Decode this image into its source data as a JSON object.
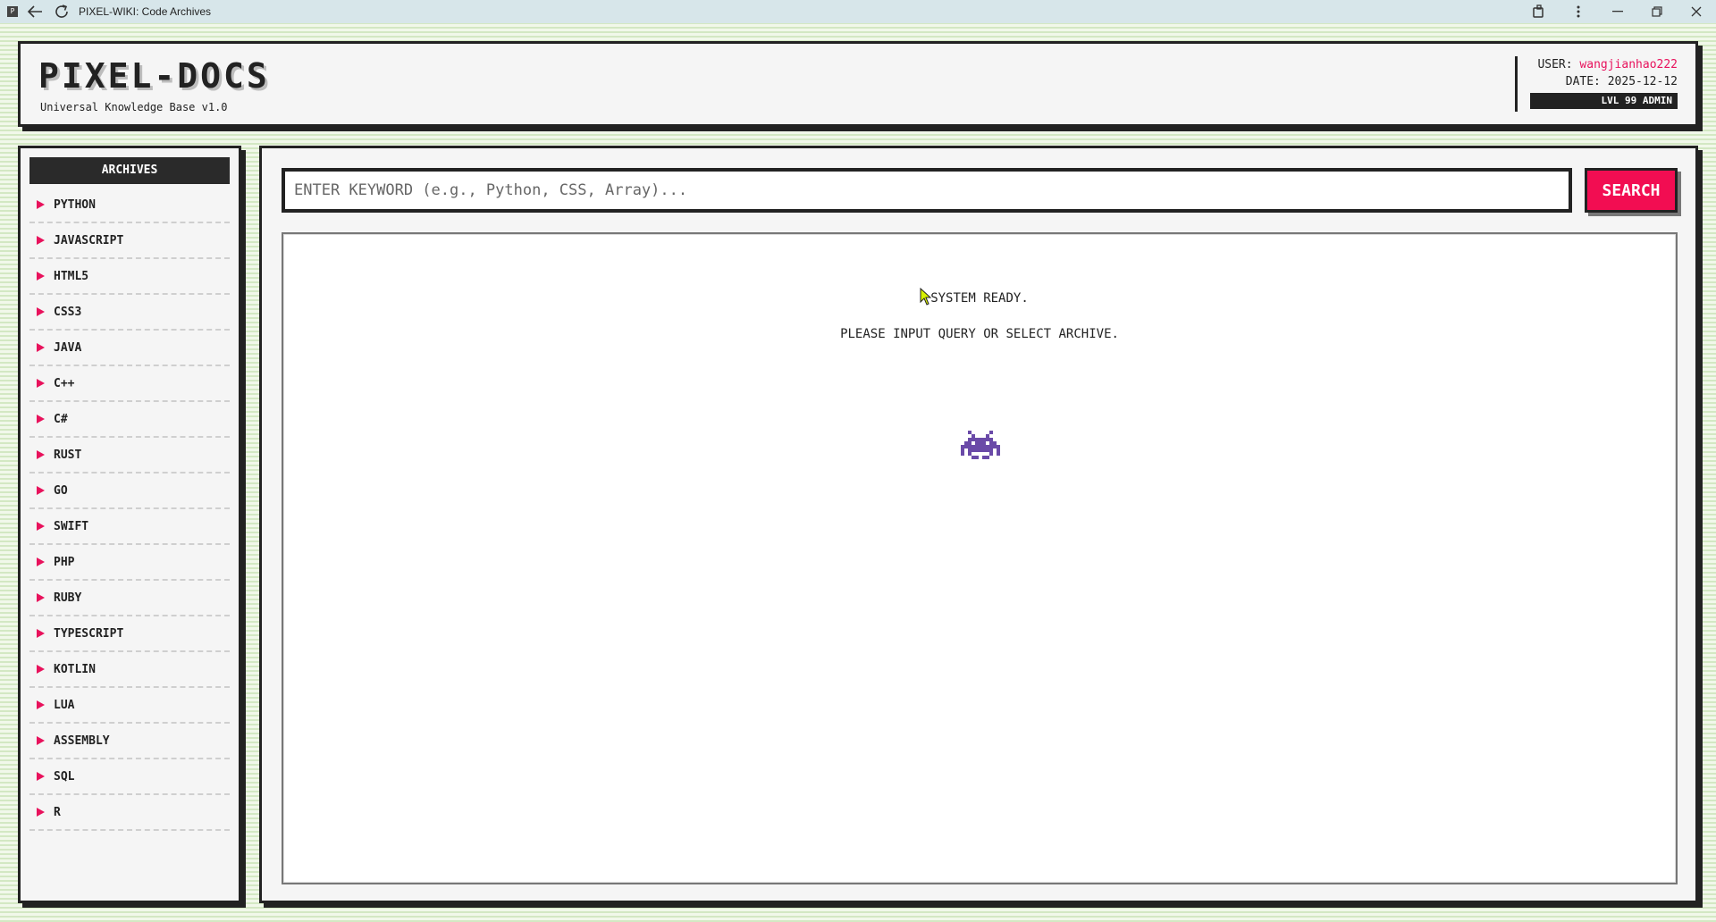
{
  "browser": {
    "favicon_letter": "P",
    "tab_title": "PIXEL-WIKI: Code Archives"
  },
  "header": {
    "title": "PIXEL-DOCS",
    "subtitle": "Universal Knowledge Base v1.0",
    "user_label": "USER:",
    "user_name": "wangjianhao222",
    "date_label": "DATE:",
    "date_value": "2025-12-12",
    "badge": "LVL 99 ADMIN"
  },
  "sidebar": {
    "heading": "ARCHIVES",
    "items": [
      {
        "label": "PYTHON"
      },
      {
        "label": "JAVASCRIPT"
      },
      {
        "label": "HTML5"
      },
      {
        "label": "CSS3"
      },
      {
        "label": "JAVA"
      },
      {
        "label": "C++"
      },
      {
        "label": "C#"
      },
      {
        "label": "RUST"
      },
      {
        "label": "GO"
      },
      {
        "label": "SWIFT"
      },
      {
        "label": "PHP"
      },
      {
        "label": "RUBY"
      },
      {
        "label": "TYPESCRIPT"
      },
      {
        "label": "KOTLIN"
      },
      {
        "label": "LUA"
      },
      {
        "label": "ASSEMBLY"
      },
      {
        "label": "SQL"
      },
      {
        "label": "R"
      }
    ]
  },
  "search": {
    "placeholder": "ENTER KEYWORD (e.g., Python, CSS, Array)...",
    "value": "",
    "button_label": "SEARCH"
  },
  "results": {
    "message_line1": "SYSTEM READY.",
    "message_line2": "PLEASE INPUT QUERY OR SELECT ARCHIVE.",
    "icon": "space-invader-icon"
  },
  "colors": {
    "accent": "#f20d52",
    "username": "#e8125c",
    "invader": "#6a4aa8",
    "panel": "#f5f5f5",
    "ink": "#222222"
  }
}
